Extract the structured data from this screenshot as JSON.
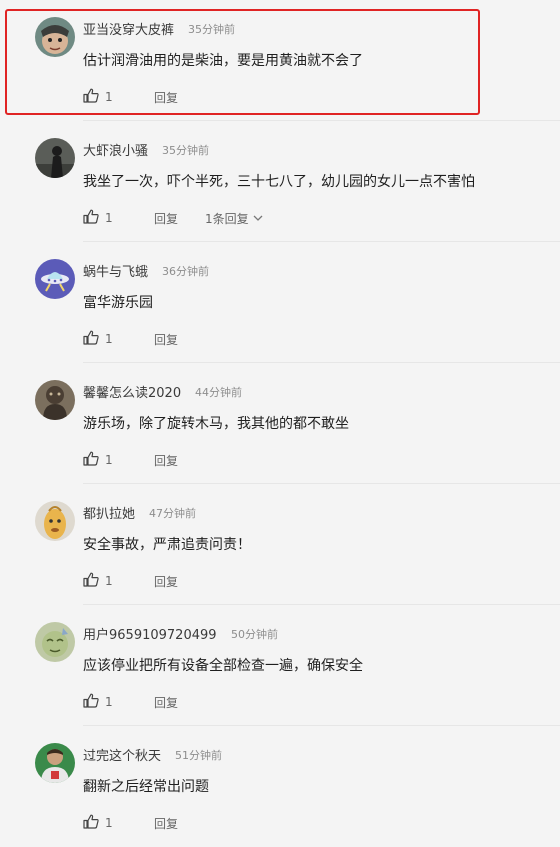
{
  "comments": [
    {
      "username": "亚当没穿大皮裤",
      "time": "35分钟前",
      "content": "估计润滑油用的是柴油，要是用黄油就不会了",
      "likes": "1",
      "reply_label": "回复",
      "reply_count": null,
      "highlighted": true,
      "avatar": "avatar-cartoon-face-icon"
    },
    {
      "username": "大虾浪小骚",
      "time": "35分钟前",
      "content": "我坐了一次，吓个半死，三十七八了，幼儿园的女儿一点不害怕",
      "likes": "1",
      "reply_label": "回复",
      "reply_count": "1条回复",
      "highlighted": false,
      "avatar": "avatar-silhouette-icon"
    },
    {
      "username": "蜗牛与飞蛾",
      "time": "36分钟前",
      "content": "富华游乐园",
      "likes": "1",
      "reply_label": "回复",
      "reply_count": null,
      "highlighted": false,
      "avatar": "avatar-ufo-icon"
    },
    {
      "username": "馨馨怎么读2020",
      "time": "44分钟前",
      "content": "游乐场，除了旋转木马，我其他的都不敢坐",
      "likes": "1",
      "reply_label": "回复",
      "reply_count": null,
      "highlighted": false,
      "avatar": "avatar-statue-icon"
    },
    {
      "username": "都扒拉她",
      "time": "47分钟前",
      "content": "安全事故，严肃追责问责！",
      "likes": "1",
      "reply_label": "回复",
      "reply_count": null,
      "highlighted": false,
      "avatar": "avatar-bean-face-icon"
    },
    {
      "username": "用户9659109720499",
      "time": "50分钟前",
      "content": "应该停业把所有设备全部检查一遍，确保安全",
      "likes": "1",
      "reply_label": "回复",
      "reply_count": null,
      "highlighted": false,
      "avatar": "avatar-green-face-icon"
    },
    {
      "username": "过完这个秋天",
      "time": "51分钟前",
      "content": "翻新之后经常出问题",
      "likes": "1",
      "reply_label": "回复",
      "reply_count": null,
      "highlighted": false,
      "avatar": "avatar-basketball-player-icon"
    }
  ],
  "colors": {
    "highlight_border": "#e02424",
    "text": "#1f1f1f",
    "meta": "#8d8d8d"
  }
}
